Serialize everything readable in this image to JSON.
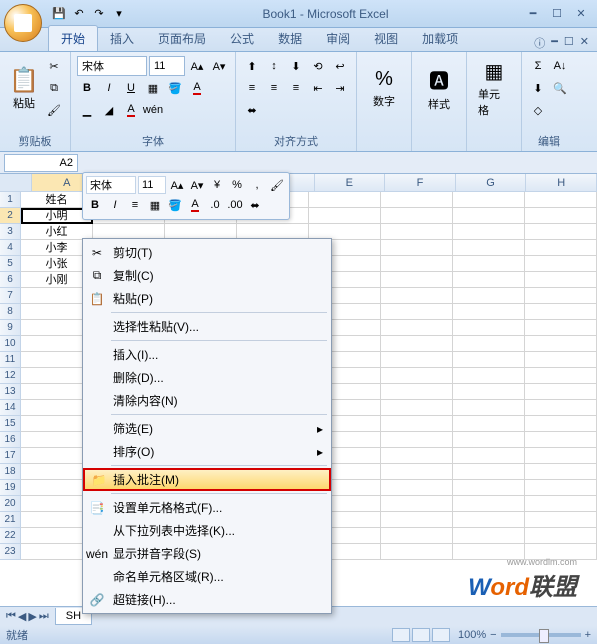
{
  "app": {
    "title": "Book1 - Microsoft Excel"
  },
  "qat": {
    "save": "💾",
    "undo": "↶",
    "redo": "↷"
  },
  "tabs": {
    "home": "开始",
    "insert": "插入",
    "pageLayout": "页面布局",
    "formulas": "公式",
    "data": "数据",
    "review": "审阅",
    "view": "视图",
    "addins": "加载项"
  },
  "ribbon": {
    "clipboard": {
      "label": "剪贴板",
      "paste": "粘贴"
    },
    "font": {
      "label": "字体",
      "name": "宋体",
      "size": "11"
    },
    "alignment": {
      "label": "对齐方式"
    },
    "number": {
      "label": "数字"
    },
    "styles": {
      "label": "样式"
    },
    "cells": {
      "label": "单元格"
    },
    "editing": {
      "label": "编辑"
    }
  },
  "nameBox": "A2",
  "miniToolbar": {
    "font": "宋体",
    "size": "11"
  },
  "columns": [
    "A",
    "B",
    "C",
    "D",
    "E",
    "F",
    "G",
    "H"
  ],
  "rowCount": 23,
  "cellData": {
    "r1c1": "姓名",
    "r2c1": "小明",
    "r3c1": "小红",
    "r4c1": "小李",
    "r5c1": "小张",
    "r6c1": "小刚"
  },
  "contextMenu": {
    "cut": "剪切(T)",
    "copy": "复制(C)",
    "paste": "粘贴(P)",
    "pasteSpecial": "选择性粘贴(V)...",
    "insert": "插入(I)...",
    "delete": "删除(D)...",
    "clearContents": "清除内容(N)",
    "filter": "筛选(E)",
    "sort": "排序(O)",
    "insertComment": "插入批注(M)",
    "formatCells": "设置单元格格式(F)...",
    "pickFromList": "从下拉列表中选择(K)...",
    "showPhonetic": "显示拼音字段(S)",
    "nameRange": "命名单元格区域(R)...",
    "hyperlink": "超链接(H)..."
  },
  "sheetTabs": {
    "sheet1": "SH"
  },
  "status": {
    "ready": "就绪",
    "zoom": "100%"
  },
  "watermark": {
    "url": "www.wordlm.com",
    "w": "W",
    "ord": "ord",
    "cn": "联盟"
  }
}
